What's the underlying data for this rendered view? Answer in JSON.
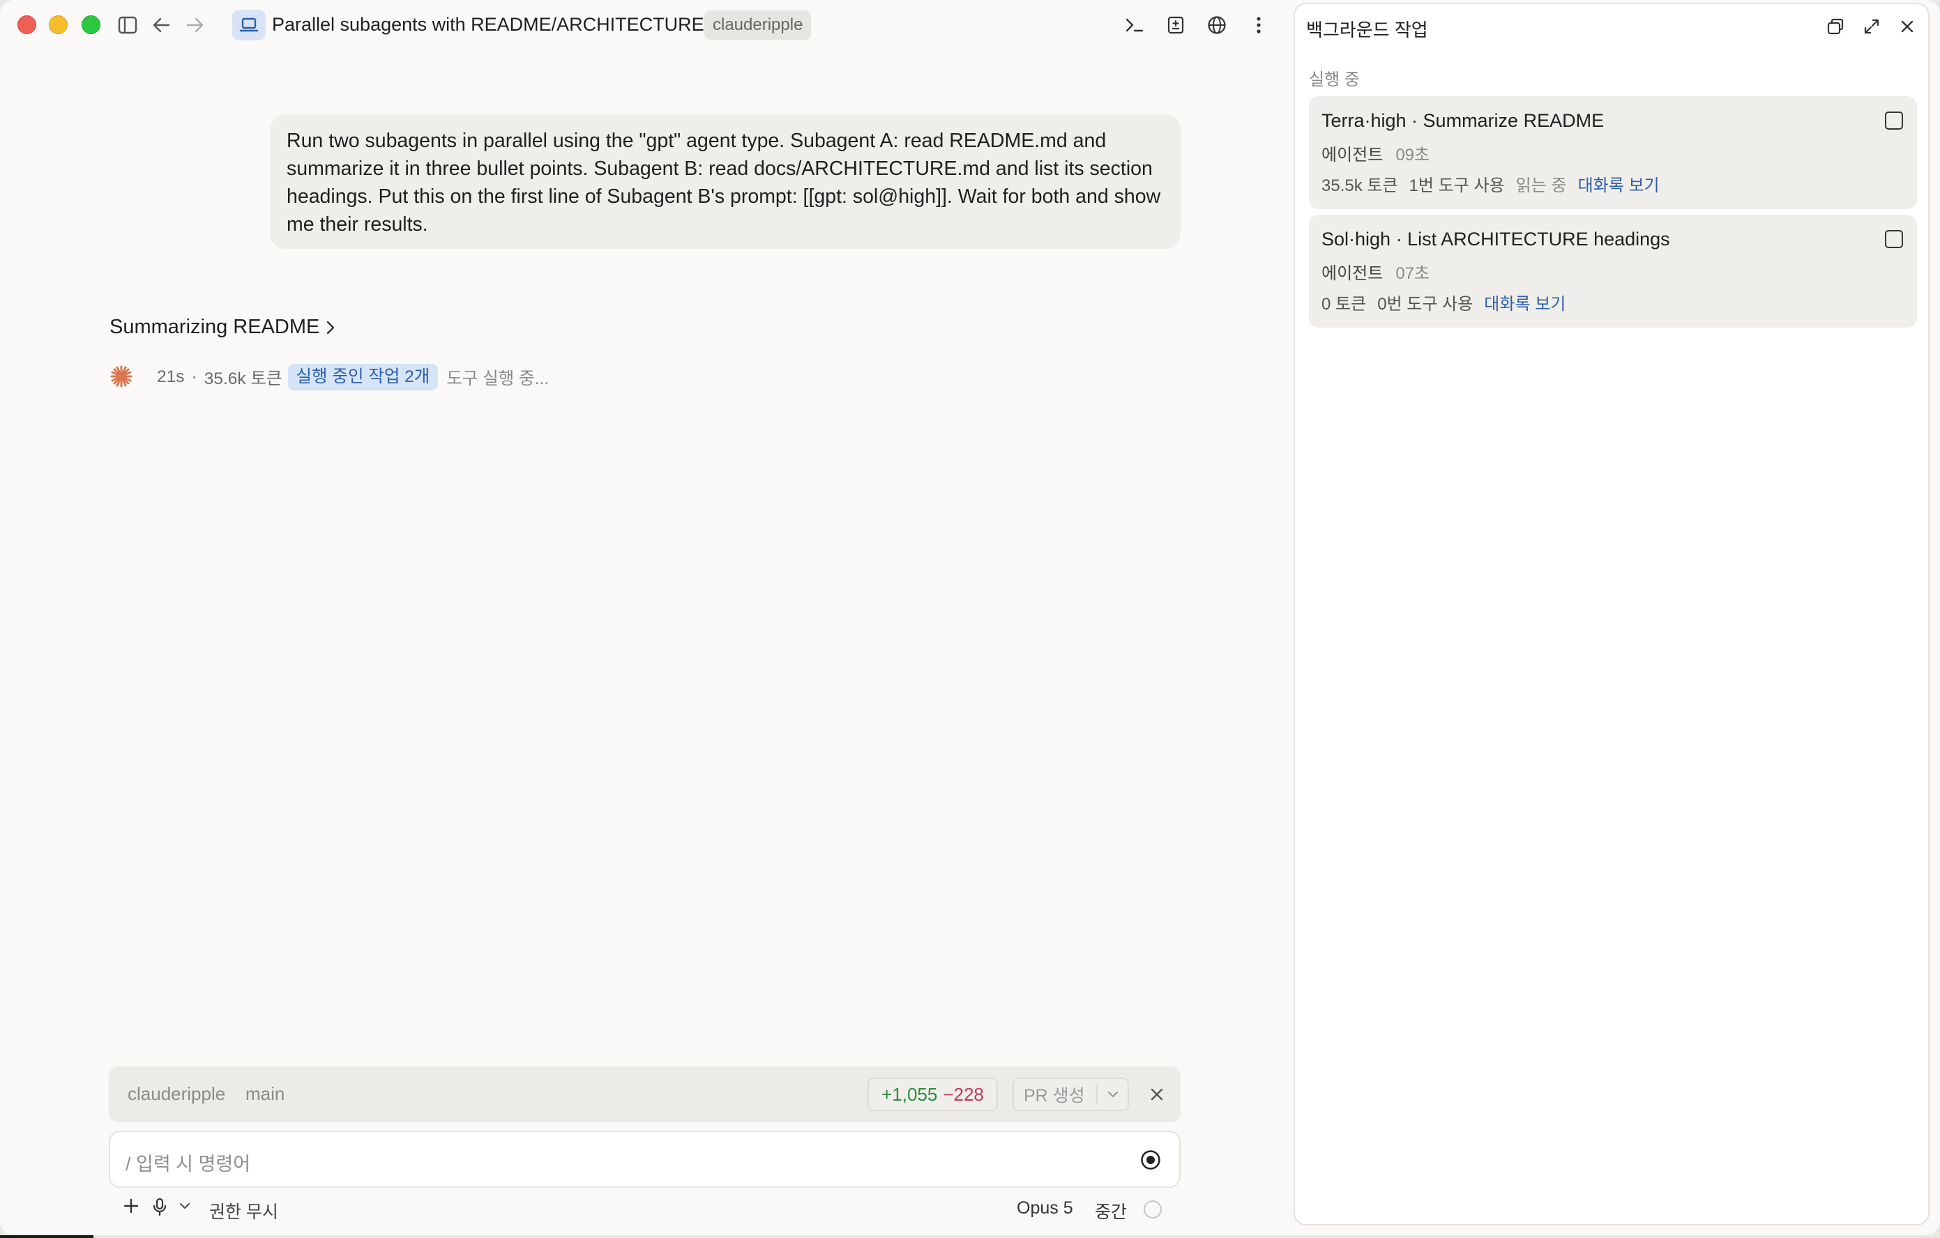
{
  "window": {
    "title": "Parallel subagents with README/ARCHITECTURE",
    "repo_badge": "clauderipple"
  },
  "chat": {
    "user_message": "Run two subagents in parallel using the \"gpt\" agent type. Subagent A: read README.md and summarize it in three bullet points. Subagent B: read docs/ARCHITECTURE.md and list its section headings. Put this on the first line of Subagent B's prompt: [[gpt: sol@high]]. Wait for both and show me their results.",
    "activity_title": "Summarizing README",
    "status": {
      "elapsed": "21s",
      "separator": "·",
      "tokens": "35.6k 토큰",
      "running_tasks": "실행 중인 작업 2개",
      "tool_status": "도구 실행 중..."
    }
  },
  "branch_bar": {
    "repo": "clauderipple",
    "branch": "main",
    "additions": "+1,055",
    "deletions": "−228",
    "pr_label": "PR 생성"
  },
  "input": {
    "placeholder": "/ 입력 시 명령어"
  },
  "footer": {
    "permission": "권한 무시",
    "model": "Opus 5",
    "effort": "중간"
  },
  "panel": {
    "title": "백그라운드 작업",
    "section": "실행 중",
    "tasks": [
      {
        "title": "Terra·high · Summarize README",
        "kind": "에이전트",
        "time": "09초",
        "tokens": "35.5k 토큰",
        "tools": "1번 도구 사용",
        "state": "읽는 중",
        "link": "대화록 보기"
      },
      {
        "title": "Sol·high · List ARCHITECTURE headings",
        "kind": "에이전트",
        "time": "07초",
        "tokens": "0 토큰",
        "tools": "0번 도구 사용",
        "state": "",
        "link": "대화록 보기"
      }
    ]
  },
  "colors": {
    "accent_blue": "#2f5fa6",
    "diff_add": "#2e8b3e",
    "diff_del": "#c23a52",
    "spinner": "#d9774f"
  }
}
